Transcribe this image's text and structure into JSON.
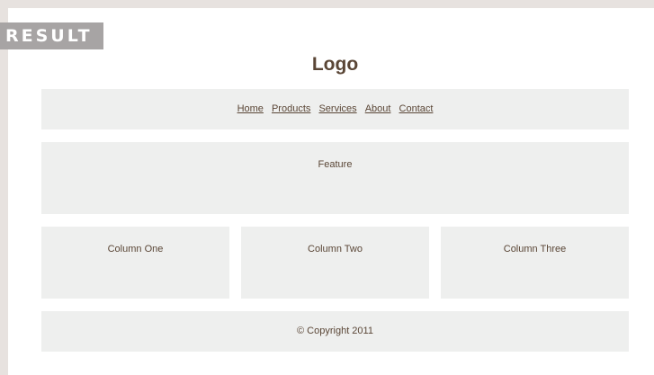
{
  "badge": "RESULT",
  "logo": "Logo",
  "nav": [
    "Home",
    "Products",
    "Services",
    "About",
    "Contact"
  ],
  "feature": "Feature",
  "columns": [
    "Column One",
    "Column Two",
    "Column Three"
  ],
  "footer": "© Copyright 2011"
}
